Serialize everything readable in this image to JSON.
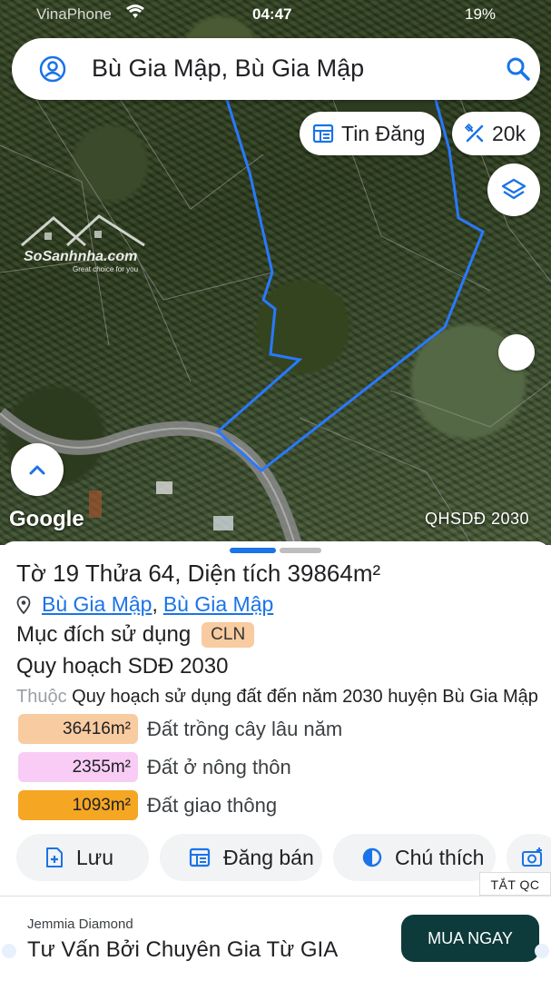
{
  "status_bar": {
    "carrier": "VinaPhone",
    "time": "04:47",
    "battery": "19%"
  },
  "search": {
    "query": "Bù Gia Mập, Bù Gia Mập"
  },
  "chips": {
    "listings_label": "Tin Đăng",
    "count_label": "20k"
  },
  "map": {
    "watermark": "SoSanhnha.com",
    "watermark_tagline": "Great choice for you",
    "attribution": "Google",
    "layer_label": "QHSDĐ 2030",
    "parcel_color": "#2979ff"
  },
  "parcel": {
    "title_prefix": "Tờ",
    "sheet_no": "19",
    "lot_prefix": "Thửa",
    "lot_no": "64",
    "area_prefix": ", Diện tích",
    "area": "39864m²",
    "location_a": "Bù Gia Mập",
    "location_sep": ",",
    "location_b": "Bù Gia Mập",
    "purpose_label": "Mục đích sử dụng",
    "purpose_code": "CLN",
    "plan_title": "Quy hoạch SDĐ 2030",
    "belongs_label": "Thuộc",
    "belongs_value": "Quy hoạch sử dụng đất đến năm 2030 huyện Bù Gia Mập",
    "zones": [
      {
        "area": "36416m²",
        "label": "Đất trồng cây lâu năm",
        "color": "#f9cba0"
      },
      {
        "area": "2355m²",
        "label": "Đất ở nông thôn",
        "color": "#f8ccf5"
      },
      {
        "area": "1093m²",
        "label": "Đất giao thông",
        "color": "#f5a623"
      }
    ]
  },
  "actions": {
    "save": "Lưu",
    "post": "Đăng bán",
    "legend": "Chú thích"
  },
  "ad": {
    "tag": "TẮT QC",
    "brand": "Jemmia Diamond",
    "headline": "Tư Vấn Bởi Chuyên Gia Từ GIA",
    "cta": "MUA NGAY"
  }
}
